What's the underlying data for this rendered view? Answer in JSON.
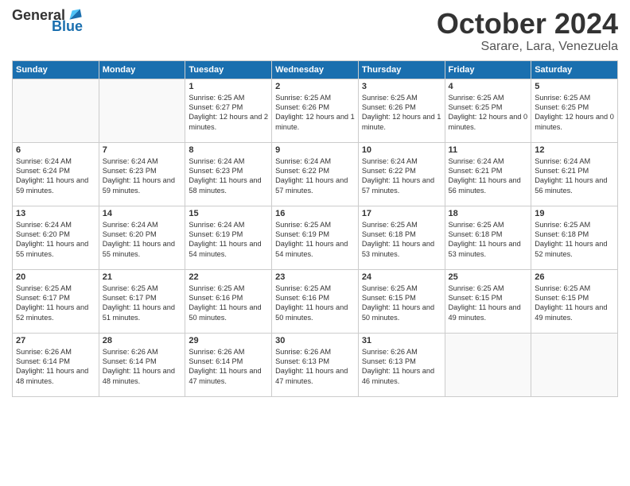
{
  "logo": {
    "general": "General",
    "blue": "Blue"
  },
  "title": {
    "month_year": "October 2024",
    "location": "Sarare, Lara, Venezuela"
  },
  "days_of_week": [
    "Sunday",
    "Monday",
    "Tuesday",
    "Wednesday",
    "Thursday",
    "Friday",
    "Saturday"
  ],
  "weeks": [
    [
      {
        "day": "",
        "text": ""
      },
      {
        "day": "",
        "text": ""
      },
      {
        "day": "1",
        "text": "Sunrise: 6:25 AM\nSunset: 6:27 PM\nDaylight: 12 hours and 2 minutes."
      },
      {
        "day": "2",
        "text": "Sunrise: 6:25 AM\nSunset: 6:26 PM\nDaylight: 12 hours and 1 minute."
      },
      {
        "day": "3",
        "text": "Sunrise: 6:25 AM\nSunset: 6:26 PM\nDaylight: 12 hours and 1 minute."
      },
      {
        "day": "4",
        "text": "Sunrise: 6:25 AM\nSunset: 6:25 PM\nDaylight: 12 hours and 0 minutes."
      },
      {
        "day": "5",
        "text": "Sunrise: 6:25 AM\nSunset: 6:25 PM\nDaylight: 12 hours and 0 minutes."
      }
    ],
    [
      {
        "day": "6",
        "text": "Sunrise: 6:24 AM\nSunset: 6:24 PM\nDaylight: 11 hours and 59 minutes."
      },
      {
        "day": "7",
        "text": "Sunrise: 6:24 AM\nSunset: 6:23 PM\nDaylight: 11 hours and 59 minutes."
      },
      {
        "day": "8",
        "text": "Sunrise: 6:24 AM\nSunset: 6:23 PM\nDaylight: 11 hours and 58 minutes."
      },
      {
        "day": "9",
        "text": "Sunrise: 6:24 AM\nSunset: 6:22 PM\nDaylight: 11 hours and 57 minutes."
      },
      {
        "day": "10",
        "text": "Sunrise: 6:24 AM\nSunset: 6:22 PM\nDaylight: 11 hours and 57 minutes."
      },
      {
        "day": "11",
        "text": "Sunrise: 6:24 AM\nSunset: 6:21 PM\nDaylight: 11 hours and 56 minutes."
      },
      {
        "day": "12",
        "text": "Sunrise: 6:24 AM\nSunset: 6:21 PM\nDaylight: 11 hours and 56 minutes."
      }
    ],
    [
      {
        "day": "13",
        "text": "Sunrise: 6:24 AM\nSunset: 6:20 PM\nDaylight: 11 hours and 55 minutes."
      },
      {
        "day": "14",
        "text": "Sunrise: 6:24 AM\nSunset: 6:20 PM\nDaylight: 11 hours and 55 minutes."
      },
      {
        "day": "15",
        "text": "Sunrise: 6:24 AM\nSunset: 6:19 PM\nDaylight: 11 hours and 54 minutes."
      },
      {
        "day": "16",
        "text": "Sunrise: 6:25 AM\nSunset: 6:19 PM\nDaylight: 11 hours and 54 minutes."
      },
      {
        "day": "17",
        "text": "Sunrise: 6:25 AM\nSunset: 6:18 PM\nDaylight: 11 hours and 53 minutes."
      },
      {
        "day": "18",
        "text": "Sunrise: 6:25 AM\nSunset: 6:18 PM\nDaylight: 11 hours and 53 minutes."
      },
      {
        "day": "19",
        "text": "Sunrise: 6:25 AM\nSunset: 6:18 PM\nDaylight: 11 hours and 52 minutes."
      }
    ],
    [
      {
        "day": "20",
        "text": "Sunrise: 6:25 AM\nSunset: 6:17 PM\nDaylight: 11 hours and 52 minutes."
      },
      {
        "day": "21",
        "text": "Sunrise: 6:25 AM\nSunset: 6:17 PM\nDaylight: 11 hours and 51 minutes."
      },
      {
        "day": "22",
        "text": "Sunrise: 6:25 AM\nSunset: 6:16 PM\nDaylight: 11 hours and 50 minutes."
      },
      {
        "day": "23",
        "text": "Sunrise: 6:25 AM\nSunset: 6:16 PM\nDaylight: 11 hours and 50 minutes."
      },
      {
        "day": "24",
        "text": "Sunrise: 6:25 AM\nSunset: 6:15 PM\nDaylight: 11 hours and 50 minutes."
      },
      {
        "day": "25",
        "text": "Sunrise: 6:25 AM\nSunset: 6:15 PM\nDaylight: 11 hours and 49 minutes."
      },
      {
        "day": "26",
        "text": "Sunrise: 6:25 AM\nSunset: 6:15 PM\nDaylight: 11 hours and 49 minutes."
      }
    ],
    [
      {
        "day": "27",
        "text": "Sunrise: 6:26 AM\nSunset: 6:14 PM\nDaylight: 11 hours and 48 minutes."
      },
      {
        "day": "28",
        "text": "Sunrise: 6:26 AM\nSunset: 6:14 PM\nDaylight: 11 hours and 48 minutes."
      },
      {
        "day": "29",
        "text": "Sunrise: 6:26 AM\nSunset: 6:14 PM\nDaylight: 11 hours and 47 minutes."
      },
      {
        "day": "30",
        "text": "Sunrise: 6:26 AM\nSunset: 6:13 PM\nDaylight: 11 hours and 47 minutes."
      },
      {
        "day": "31",
        "text": "Sunrise: 6:26 AM\nSunset: 6:13 PM\nDaylight: 11 hours and 46 minutes."
      },
      {
        "day": "",
        "text": ""
      },
      {
        "day": "",
        "text": ""
      }
    ]
  ]
}
